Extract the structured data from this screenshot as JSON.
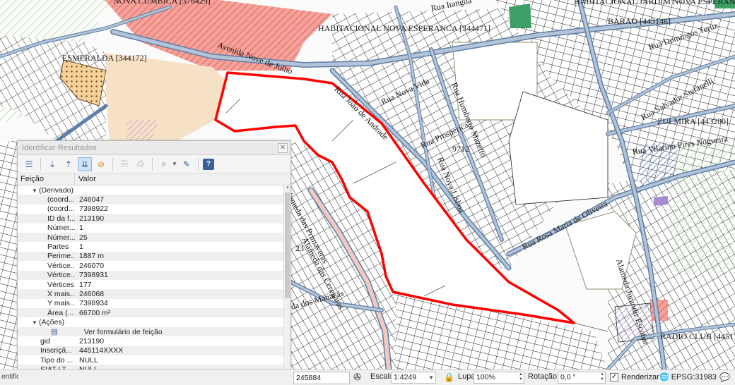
{
  "map": {
    "labels": {
      "nova_cumbica": "NOVA CUMBICA [376429]",
      "rua_itangua": "Rua Itanguá",
      "habitacional_jardim": "HABITACIONAL JARDIM NOVA ESPERANCA [1",
      "habitacional_nova": "HABITACIONAL NOVA ESPERANCA [344471]",
      "barao": "BARAO [443146]",
      "rua_domingos": "Rua Domingos Teruz",
      "esmeralda": "ESMERALDA [344172]",
      "avenida_nove": "Avenida Nove de Julho",
      "rua_joao": "Rua João de Andrade",
      "rua_nova_vida": "Rua Nova Vida",
      "rua_humberto": "Rua Humberto Mazetto",
      "rua_salvador": "Rua Salvador Stefanelli",
      "rua_prosperica": "Rua Prosperica",
      "zulmira": "ZULMIRA [443280]",
      "rua_nova_lisboa": "Rua Nova Lisboa",
      "num_9712": "9712",
      "rua_vilarino": "Rua Vilarino Pires Nogueira",
      "rua_rosa": "Rua Rosa Maria de Oliveira",
      "alameda_primaveras": "Alameda das Primaveras",
      "alameda_cerejeiras": "Alameda das Cerejeiras",
      "alameda_jurandir": "Alameda Jurandir Escobar",
      "num_23": "23",
      "alameda_manacas": "da dos Manacás",
      "radio_club": "RADIO CLUB [44517"
    },
    "colors": {
      "parcel_line": "#1f1f1f",
      "road_fill": "#b4c3d6",
      "road_edge": "#5d7fa8",
      "highlight": "#ff0000",
      "zone_orange": "#f7e1c6",
      "zone_pink": "#ef8f8f",
      "hatch_green": "#bde3b2"
    }
  },
  "identify": {
    "title": "Identificar Resultados",
    "col_feature": "Feição",
    "col_value": "Valor",
    "toolbar_icons": [
      "expand-tree-icon",
      "expand-all-icon",
      "collapse-all-icon",
      "expand-new-icon",
      "clear-results-icon",
      "copy-icon",
      "print-icon",
      "identify-mode-icon",
      "settings-icon",
      "help-icon"
    ],
    "derived_group": "(Derivado)",
    "derived": [
      {
        "key": "(coord...",
        "value": "246047"
      },
      {
        "key": "(coord...",
        "value": "7398922"
      },
      {
        "key": "ID da f...",
        "value": "213190"
      },
      {
        "key": "Númer...",
        "value": "1"
      },
      {
        "key": "Númer...",
        "value": "25"
      },
      {
        "key": "Partes",
        "value": "1"
      },
      {
        "key": "Perime...",
        "value": "1887 m"
      },
      {
        "key": "Vértice...",
        "value": "246070"
      },
      {
        "key": "Vértice...",
        "value": "7398931"
      },
      {
        "key": "Vértices",
        "value": "177"
      },
      {
        "key": "X mais...",
        "value": "246068"
      },
      {
        "key": "Y mais...",
        "value": "7398934"
      },
      {
        "key": "Área (...",
        "value": "66700 m²"
      }
    ],
    "actions_group": "(Ações)",
    "action_label": "Ver formulário de feição",
    "attributes": [
      {
        "key": "gid",
        "value": "213190"
      },
      {
        "key": "Inscriçã...",
        "value": "445114XXXX"
      },
      {
        "key": "Tipo do ...",
        "value": "NULL"
      },
      {
        "key": "SIAT-LT_...",
        "value": "NULL"
      },
      {
        "key": "SIAT-LT_...",
        "value": "NULL"
      }
    ]
  },
  "status": {
    "left_text": "entifica",
    "coordinate": "245884 7398635",
    "scale_label": "Escala",
    "scale_value": "1:4249",
    "magnifier_label": "Lupa",
    "magnifier_value": "100%",
    "rotation_label": "Rotação",
    "rotation_value": "0,0 °",
    "render_label": "Renderizar",
    "crs": "EPSG:31983"
  }
}
